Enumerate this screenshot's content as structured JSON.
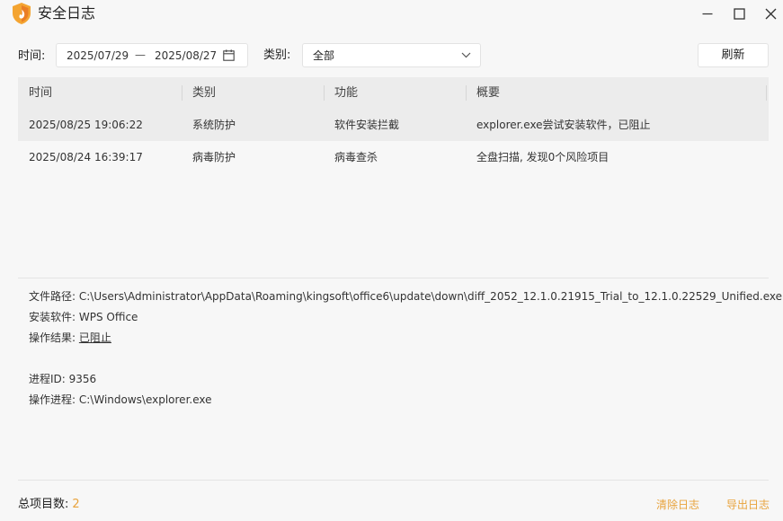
{
  "window": {
    "title": "安全日志"
  },
  "filters": {
    "time_label": "时间:",
    "date_start": "2025/07/29",
    "date_separator": "—",
    "date_end": "2025/08/27",
    "category_label": "类别:",
    "category_value": "全部",
    "refresh_label": "刷新"
  },
  "table": {
    "headers": [
      "时间",
      "类别",
      "功能",
      "概要"
    ],
    "rows": [
      {
        "time": "2025/08/25 19:06:22",
        "category": "系统防护",
        "function": "软件安装拦截",
        "summary": "explorer.exe尝试安装软件，已阻止",
        "selected": true
      },
      {
        "time": "2025/08/24 16:39:17",
        "category": "病毒防护",
        "function": "病毒查杀",
        "summary": "全盘扫描, 发现0个风险项目",
        "selected": false
      }
    ]
  },
  "details": {
    "file_path_label": "文件路径:",
    "file_path": "C:\\Users\\Administrator\\AppData\\Roaming\\kingsoft\\office6\\update\\down\\diff_2052_12.1.0.21915_Trial_to_12.1.0.22529_Unified.exe",
    "software_label": "安装软件:",
    "software": "WPS Office",
    "result_label": "操作结果:",
    "result": "已阻止",
    "pid_label": "进程ID:",
    "pid": "9356",
    "process_label": "操作进程:",
    "process": "C:\\Windows\\explorer.exe"
  },
  "footer": {
    "total_label": "总项目数:",
    "total_count": "2",
    "clear_label": "清除日志",
    "export_label": "导出日志"
  },
  "icons": {
    "logo": "flame-shield-icon",
    "minimize": "minimize-icon",
    "maximize": "maximize-icon",
    "close": "close-icon",
    "calendar": "calendar-icon",
    "dropdown": "chevron-down-icon"
  },
  "colors": {
    "accent": "#e8a33c",
    "selected_row": "#ececec",
    "background": "#f7f7f7"
  }
}
